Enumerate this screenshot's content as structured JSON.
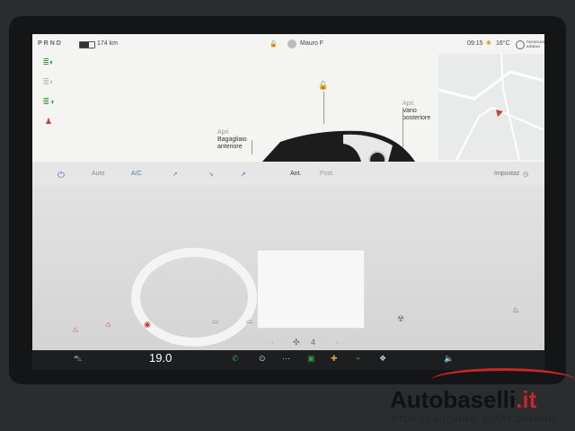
{
  "statusbar": {
    "gear": "PRND",
    "range": "174 km",
    "profile": "Mauro F",
    "time": "09:15",
    "temperature": "16°C",
    "extra": "",
    "airbag": "PASSENGER AIRBAG"
  },
  "car": {
    "frunk_action": "Apri",
    "frunk_label": "Bagagliaio anteriore",
    "trunk_action": "Apri",
    "trunk_label": "Vano posteriore"
  },
  "climate": {
    "auto": "Auto",
    "ac": "A/C",
    "front": "Ant.",
    "rear": "Post.",
    "settings": "Impostaz",
    "fan_speed": "4",
    "cabin_temp": "19.0"
  },
  "colors": {
    "accent": "#3e78c4",
    "brand": "#c62828"
  },
  "watermark": {
    "brand": "Autobaselli",
    "tld": ".it",
    "tagline": "STOP SEARCHING. START DRIVING."
  }
}
